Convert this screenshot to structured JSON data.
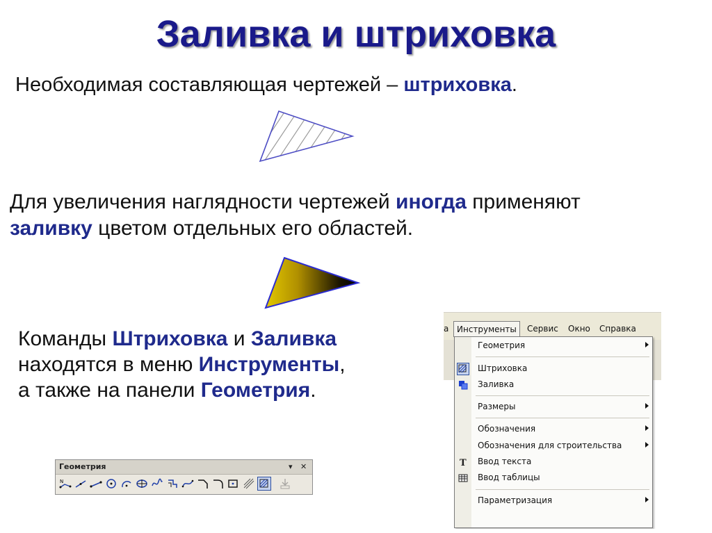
{
  "title": "Заливка и штриховка",
  "p1": {
    "pre": "Необходимая составляющая чертежей – ",
    "hl": "штриховка",
    "post": "."
  },
  "p2": {
    "l1_pre": "Для увеличения наглядности чертежей ",
    "l1_hl": "иногда",
    "l1_post": " применяют",
    "l2_hl": "заливку",
    "l2_post": " цветом отдельных его областей."
  },
  "p3": {
    "l1_pre": "Команды ",
    "l1_hl1": "Штриховка",
    "l1_mid": " и ",
    "l1_hl2": "Заливка",
    "l2_pre": "находятся в меню ",
    "l2_hl": "Инструменты",
    "l2_post": ",",
    "l3_pre": "а также на панели ",
    "l3_hl": "Геометрия",
    "l3_post": "."
  },
  "toolbar": {
    "title": "Геометрия",
    "dropdown": "▾",
    "close": "✕"
  },
  "menubar": {
    "partial": "а",
    "items": [
      "Инструменты",
      "Сервис",
      "Окно",
      "Справка"
    ]
  },
  "menu": {
    "items": [
      {
        "label": "Геометрия",
        "submenu": true
      },
      {
        "label": "Штриховка",
        "icon": "hatch-icon",
        "checked": true
      },
      {
        "label": "Заливка",
        "icon": "fill-icon"
      },
      {
        "label": "Размеры",
        "submenu": true
      },
      {
        "label": "Обозначения",
        "submenu": true
      },
      {
        "label": "Обозначения для строительства",
        "submenu": true
      },
      {
        "label": "Ввод текста",
        "icon": "text-icon"
      },
      {
        "label": "Ввод таблицы",
        "icon": "table-icon"
      },
      {
        "label": "Параметризация",
        "submenu": true
      }
    ]
  },
  "colors": {
    "accent": "#1f2a8c",
    "fill_start": "#c9a600",
    "fill_end": "#000000",
    "outline": "#2b2bd1"
  }
}
